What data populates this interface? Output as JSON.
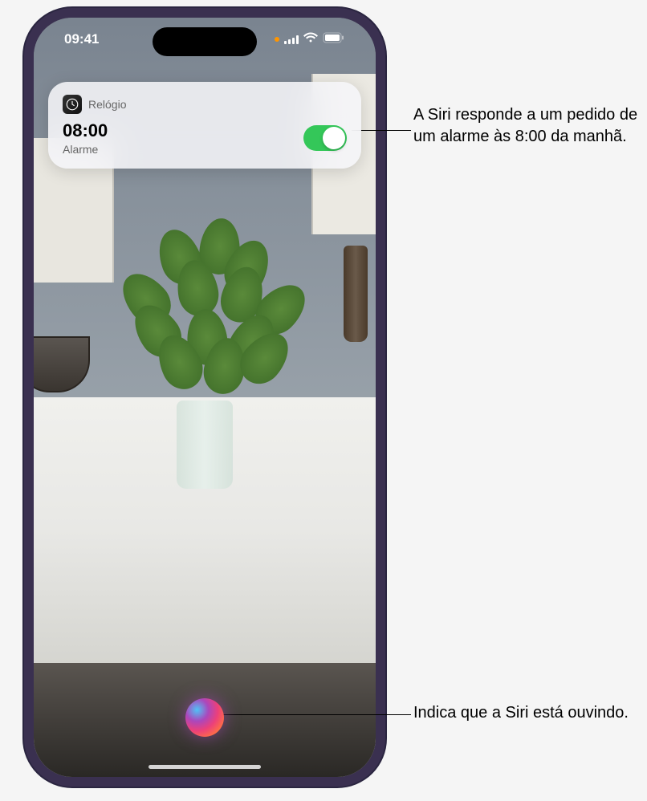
{
  "status_bar": {
    "time": "09:41"
  },
  "notification": {
    "app_name": "Relógio",
    "time": "08:00",
    "label": "Alarme",
    "toggle_on": true
  },
  "callouts": {
    "top": "A Siri responde a um pedido de um alarme às 8:00 da manhã.",
    "bottom": "Indica que a Siri está ouvindo."
  }
}
